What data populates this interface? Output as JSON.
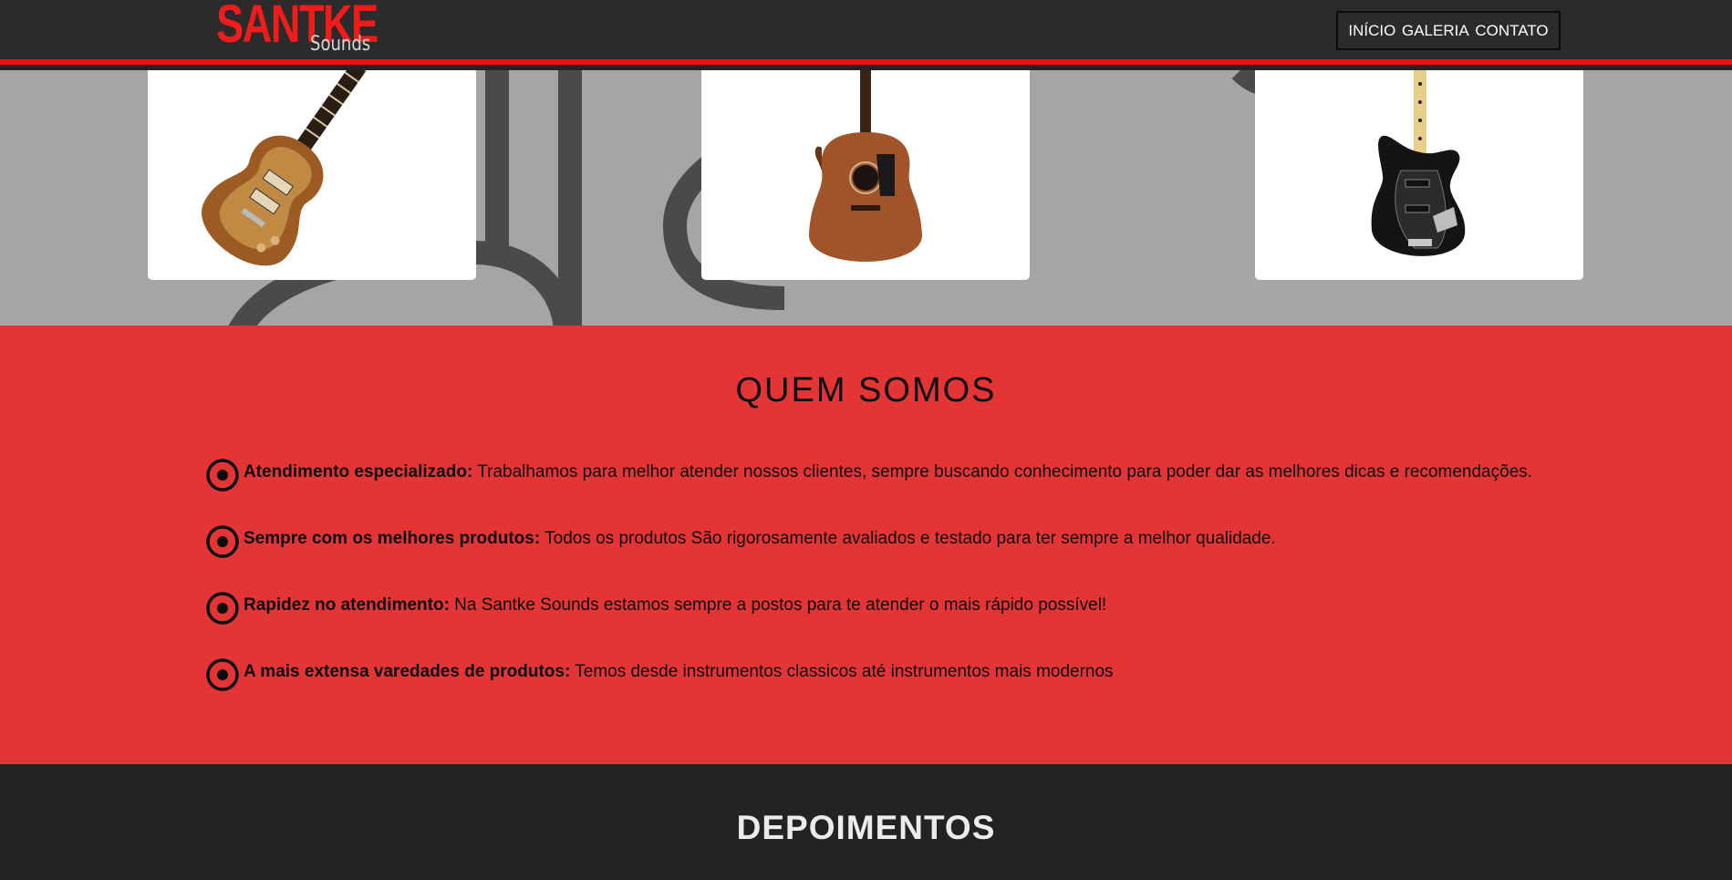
{
  "brand": {
    "name": "SANTKE",
    "tagline": "Sounds",
    "accent": "#f10f0f"
  },
  "nav": {
    "items": [
      "INÍCIO",
      "GALERIA",
      "CONTATO"
    ]
  },
  "gallery": {
    "items": [
      {
        "name": "electric-guitar"
      },
      {
        "name": "acoustic-guitar"
      },
      {
        "name": "bass-guitar"
      }
    ]
  },
  "about": {
    "title": "QUEM SOMOS",
    "features": [
      {
        "title": "Atendimento especializado:",
        "text": " Trabalhamos para melhor atender nossos clientes, sempre buscando conhecimento para poder dar as melhores dicas e recomendações.",
        "icon": "target-circle-icon"
      },
      {
        "title": "Sempre com os melhores produtos:",
        "text": " Todos os produtos São rigorosamente avaliados e testado para ter sempre a melhor qualidade.",
        "icon": "target-circle-icon"
      },
      {
        "title": "Rapidez no atendimento:",
        "text": " Na Santke Sounds estamos sempre a postos para te atender o mais rápido possível!",
        "icon": "target-circle-icon"
      },
      {
        "title": "A mais extensa varedades de produtos:",
        "text": " Temos desde instrumentos classicos até instrumentos mais modernos",
        "icon": "target-circle-icon"
      }
    ],
    "background": "#e43536"
  },
  "testimonials": {
    "title": "DEPOIMENTOS"
  }
}
